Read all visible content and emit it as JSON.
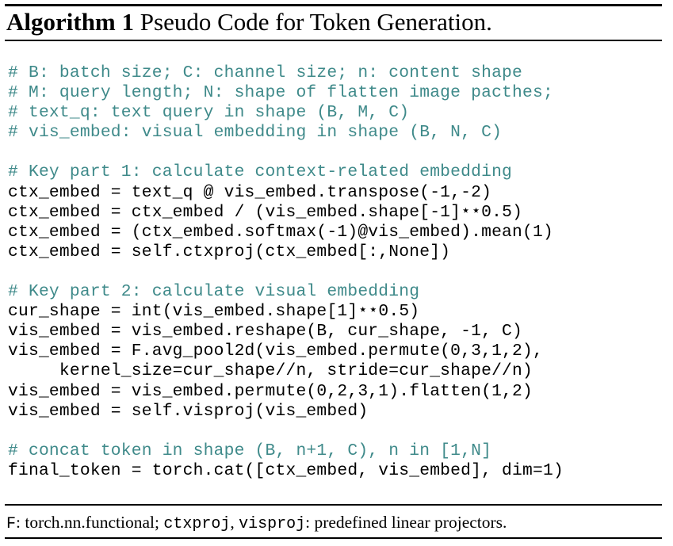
{
  "algorithm": {
    "label": "Algorithm 1",
    "caption": "Pseudo Code for Token Generation."
  },
  "code_lines": [
    {
      "type": "comment",
      "text": "# B: batch size; C: channel size; n: content shape"
    },
    {
      "type": "comment",
      "text": "# M: query length; N: shape of flatten image pacthes;"
    },
    {
      "type": "comment",
      "text": "# text_q: text query in shape (B, M, C)"
    },
    {
      "type": "comment",
      "text": "# vis_embed: visual embedding in shape (B, N, C)"
    },
    {
      "type": "blank",
      "text": ""
    },
    {
      "type": "comment",
      "text": "# Key part 1: calculate context-related embedding"
    },
    {
      "type": "code",
      "text": "ctx_embed = text_q @ vis_embed.transpose(-1,-2)"
    },
    {
      "type": "code",
      "text": "ctx_embed = ctx_embed / (vis_embed.shape[-1]⋆⋆0.5)"
    },
    {
      "type": "code",
      "text": "ctx_embed = (ctx_embed.softmax(-1)@vis_embed).mean(1)"
    },
    {
      "type": "code",
      "text": "ctx_embed = self.ctxproj(ctx_embed[:,None])"
    },
    {
      "type": "blank",
      "text": ""
    },
    {
      "type": "comment",
      "text": "# Key part 2: calculate visual embedding"
    },
    {
      "type": "code",
      "text": "cur_shape = int(vis_embed.shape[1]⋆⋆0.5)"
    },
    {
      "type": "code",
      "text": "vis_embed = vis_embed.reshape(B, cur_shape, -1, C)"
    },
    {
      "type": "code",
      "text": "vis_embed = F.avg_pool2d(vis_embed.permute(0,3,1,2),"
    },
    {
      "type": "code",
      "text": "     kernel_size=cur_shape//n, stride=cur_shape//n)"
    },
    {
      "type": "code",
      "text": "vis_embed = vis_embed.permute(0,2,3,1).flatten(1,2)"
    },
    {
      "type": "code",
      "text": "vis_embed = self.visproj(vis_embed)"
    },
    {
      "type": "blank",
      "text": ""
    },
    {
      "type": "comment",
      "text": "# concat token in shape (B, n+1, C), n in [1,N]"
    },
    {
      "type": "code",
      "text": "final_token = torch.cat([ctx_embed, vis_embed], dim=1)"
    }
  ],
  "footnote": {
    "f_symbol": "F",
    "f_desc": ": torch.nn.functional; ",
    "ctxproj": "ctxproj",
    "sep": ", ",
    "visproj": "visproj",
    "tail": ": predefined linear projectors."
  },
  "colors": {
    "comment": "#3f8a8a",
    "text": "#000000"
  }
}
